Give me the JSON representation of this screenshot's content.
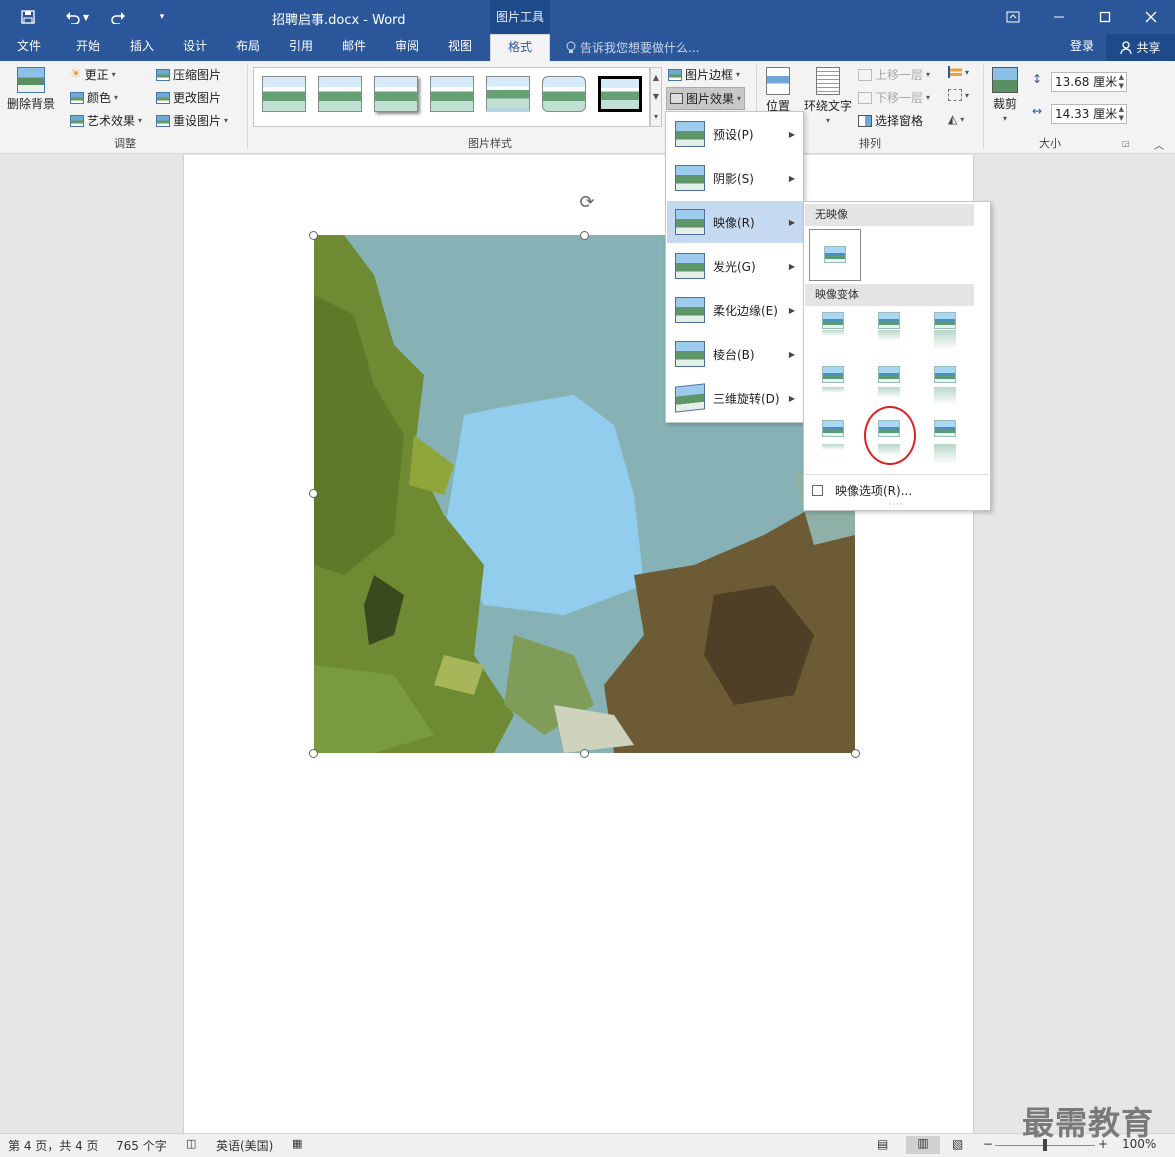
{
  "titlebar": {
    "document_title": "招聘启事.docx - Word",
    "context_tab": "图片工具"
  },
  "tabs": [
    "文件",
    "开始",
    "插入",
    "设计",
    "布局",
    "引用",
    "邮件",
    "审阅",
    "视图",
    "格式"
  ],
  "active_tab": "格式",
  "tell_me": "告诉我您想要做什么...",
  "account": {
    "login": "登录",
    "share": "共享"
  },
  "ribbon": {
    "adjust": {
      "remove_background": "删除背景",
      "corrections": "更正",
      "color": "颜色",
      "artistic_effects": "艺术效果",
      "compress": "压缩图片",
      "change": "更改图片",
      "reset": "重设图片",
      "group_label": "调整"
    },
    "styles": {
      "border": "图片边框",
      "effects": "图片效果",
      "group_label": "图片样式"
    },
    "arrange": {
      "position": "位置",
      "wrap_text": "环绕文字",
      "bring_forward": "上移一层",
      "send_backward": "下移一层",
      "selection_pane": "选择窗格",
      "group_label": "排列"
    },
    "size": {
      "crop": "裁剪",
      "height": "13.68 厘米",
      "width": "14.33 厘米",
      "group_label": "大小"
    }
  },
  "effects_menu": [
    {
      "label": "预设(P)"
    },
    {
      "label": "阴影(S)"
    },
    {
      "label": "映像(R)"
    },
    {
      "label": "发光(G)"
    },
    {
      "label": "柔化边缘(E)"
    },
    {
      "label": "棱台(B)"
    },
    {
      "label": "三维旋转(D)"
    }
  ],
  "reflection_menu": {
    "no_reflection": "无映像",
    "variants": "映像变体",
    "options": "映像选项(R)..."
  },
  "statusbar": {
    "page": "第 4 页，共 4 页",
    "words": "765 个字",
    "language": "英语(美国)",
    "zoom": "100%"
  },
  "watermark": "最需教育",
  "colors": {
    "accent": "#2b579a",
    "highlight": "#c5d9f1",
    "circle": "#e02020"
  }
}
